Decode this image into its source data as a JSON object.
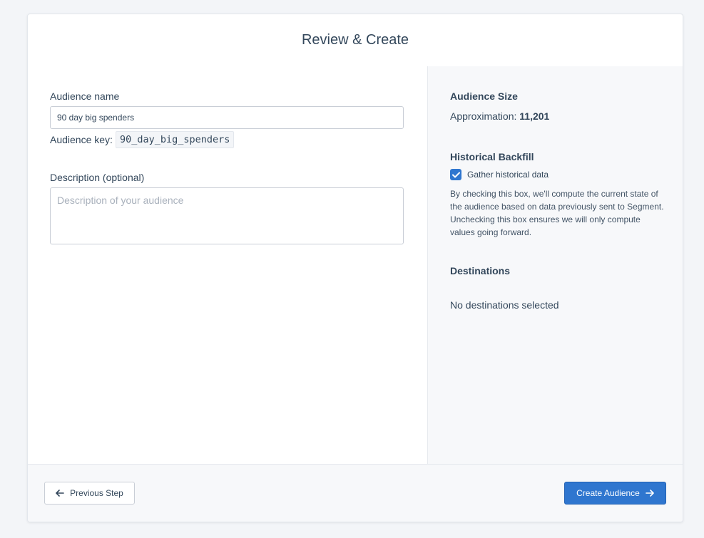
{
  "header": {
    "title": "Review & Create"
  },
  "form": {
    "name_label": "Audience name",
    "name_value": "90 day big spenders",
    "key_label": "Audience key:",
    "key_value": "90_day_big_spenders",
    "description_label": "Description (optional)",
    "description_placeholder": "Description of your audience",
    "description_value": ""
  },
  "summary": {
    "size_title": "Audience Size",
    "approx_label": "Approximation:",
    "approx_value": "11,201",
    "backfill_title": "Historical Backfill",
    "backfill_checkbox_label": "Gather historical data",
    "backfill_checked": true,
    "backfill_help": "By checking this box, we'll compute the current state of the audience based on data previously sent to Segment. Unchecking this box ensures we will only compute values going forward.",
    "destinations_title": "Destinations",
    "destinations_empty": "No destinations selected"
  },
  "footer": {
    "prev_label": "Previous Step",
    "create_label": "Create Audience"
  },
  "colors": {
    "accent": "#2f76cf",
    "text": "#33475b",
    "background": "#f3f5f8"
  },
  "icons": {
    "prev": "arrow-left-icon",
    "create": "arrow-right-icon",
    "check": "checkmark-icon"
  }
}
